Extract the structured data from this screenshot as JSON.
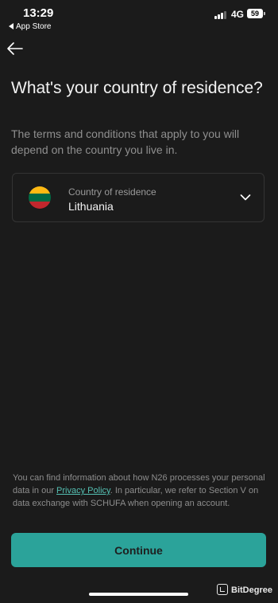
{
  "status_bar": {
    "time": "13:29",
    "back_app": "App Store",
    "network": "4G",
    "battery": "59"
  },
  "title": "What's your country of residence?",
  "subtitle": "The terms and conditions that apply to you will depend on the country you live in.",
  "country_select": {
    "label": "Country of residence",
    "value": "Lithuania",
    "flag_colors": [
      "#fdb913",
      "#006a44",
      "#c1272d"
    ]
  },
  "info": {
    "text_before": "You can find information about how N26 processes your personal data in our ",
    "link": "Privacy Policy",
    "text_after": ". In particular, we refer to Section V on data exchange with SCHUFA when opening an account."
  },
  "continue_label": "Continue",
  "watermark": "BitDegree",
  "colors": {
    "background": "#1b1b1b",
    "accent": "#2ba39a",
    "link": "#55c0b3"
  }
}
